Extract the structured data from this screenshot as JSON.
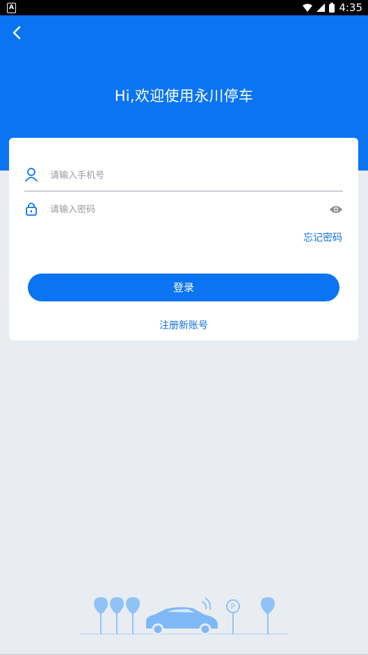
{
  "status_bar": {
    "time": "4:35"
  },
  "header": {
    "title": "Hi,欢迎使用永川停车"
  },
  "login_form": {
    "phone_placeholder": "请输入手机号",
    "password_placeholder": "请输入密码",
    "forgot_password": "忘记密码",
    "login_button": "登录",
    "register_link": "注册新账号"
  },
  "colors": {
    "brand_blue": "#0a74f2",
    "link_blue": "#1270de",
    "background": "#e9edf1"
  },
  "icons": [
    "back-arrow-icon",
    "user-icon",
    "lock-icon",
    "eye-icon",
    "parking-illustration"
  ]
}
